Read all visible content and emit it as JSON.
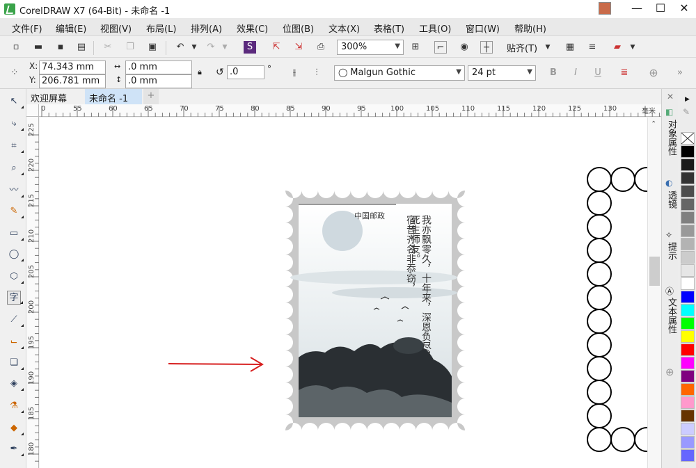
{
  "window": {
    "title": "CorelDRAW X7 (64-Bit) - 未命名 -1",
    "minimize": "—",
    "maximize": "☐",
    "close": "✕"
  },
  "menu": [
    "文件(F)",
    "编辑(E)",
    "视图(V)",
    "布局(L)",
    "排列(A)",
    "效果(C)",
    "位图(B)",
    "文本(X)",
    "表格(T)",
    "工具(O)",
    "窗口(W)",
    "帮助(H)"
  ],
  "toolbar": {
    "zoom": "300%",
    "snap_label": "贴齐(T)"
  },
  "props": {
    "x_label": "X:",
    "x_value": "74.343 mm",
    "y_label": "Y:",
    "y_value": "206.781 mm",
    "w_value": ".0 mm",
    "h_value": ".0 mm",
    "angle_value": ".0",
    "degree": "°",
    "font": "Malgun Gothic",
    "font_size": "24 pt",
    "bold": "B",
    "italic": "I",
    "underline": "U"
  },
  "tabs": [
    {
      "label": "欢迎屏幕",
      "active": false
    },
    {
      "label": "未命名 -1",
      "active": true
    }
  ],
  "tab_add": "+",
  "ruler": {
    "h_ticks": [
      "0",
      "55",
      "60",
      "65",
      "70",
      "75",
      "80",
      "85",
      "90",
      "95",
      "100",
      "105",
      "110",
      "115",
      "120",
      "125",
      "130"
    ],
    "h_unit": "毫米",
    "v_ticks": [
      "225",
      "220",
      "215",
      "210",
      "205",
      "200",
      "195",
      "190",
      "185",
      "180"
    ]
  },
  "stamp": {
    "header": "中国邮政",
    "poem_col1": "我亦飘零久，十年来，深恩负尽，死生师友。",
    "poem_col2": "宿昔齐名非忝窃，"
  },
  "docker_tabs": [
    "对象属性",
    "透镜",
    "提示",
    "文本属性"
  ],
  "palette": [
    "#000000",
    "#1a1a1a",
    "#333333",
    "#4d4d4d",
    "#666666",
    "#808080",
    "#999999",
    "#b3b3b3",
    "#cccccc",
    "#e6e6e6",
    "#ffffff",
    "#0000ff",
    "#00ffff",
    "#00ff00",
    "#ffff00",
    "#ff0000",
    "#ff00ff",
    "#800080",
    "#ff6600",
    "#ff99cc",
    "#663300",
    "#ccccff",
    "#9999ff",
    "#6666ff"
  ],
  "colors": {
    "accent": "#d71f1f",
    "stamp_border": "#c8c8c8"
  }
}
